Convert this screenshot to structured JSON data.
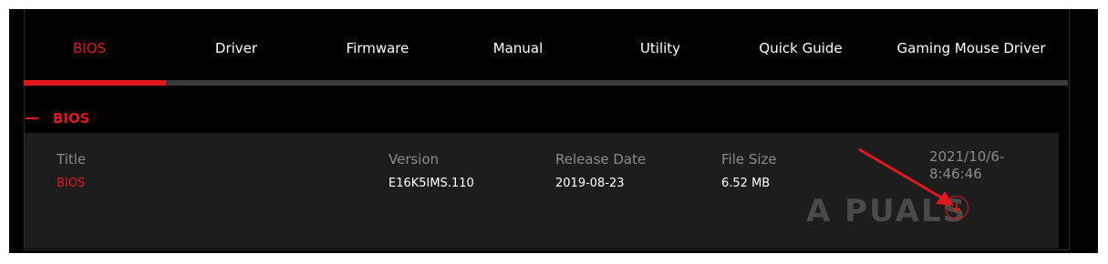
{
  "tabs": [
    {
      "label": "BIOS",
      "active": true
    },
    {
      "label": "Driver",
      "active": false
    },
    {
      "label": "Firmware",
      "active": false
    },
    {
      "label": "Manual",
      "active": false
    },
    {
      "label": "Utility",
      "active": false
    },
    {
      "label": "Quick Guide",
      "active": false
    },
    {
      "label": "Gaming Mouse Driver",
      "active": false
    }
  ],
  "section": {
    "title": "BIOS"
  },
  "columns": {
    "title": "Title",
    "version": "Version",
    "release_date": "Release Date",
    "file_size": "File Size"
  },
  "row": {
    "title": "BIOS",
    "version": "E16K5IMS.110",
    "release_date": "2019-08-23",
    "file_size": "6.52 MB"
  },
  "timestamp": "2021/10/6-\n8:46:46",
  "watermark": "A PUALS",
  "icons": {
    "collapse": "minus-icon",
    "download": "download-arrow-icon",
    "annotation": "annotation-arrow-icon"
  },
  "colors": {
    "accent": "#e0171c",
    "background": "#000000",
    "panel": "#1d1d1d",
    "muted_text": "#8a8a8a"
  }
}
